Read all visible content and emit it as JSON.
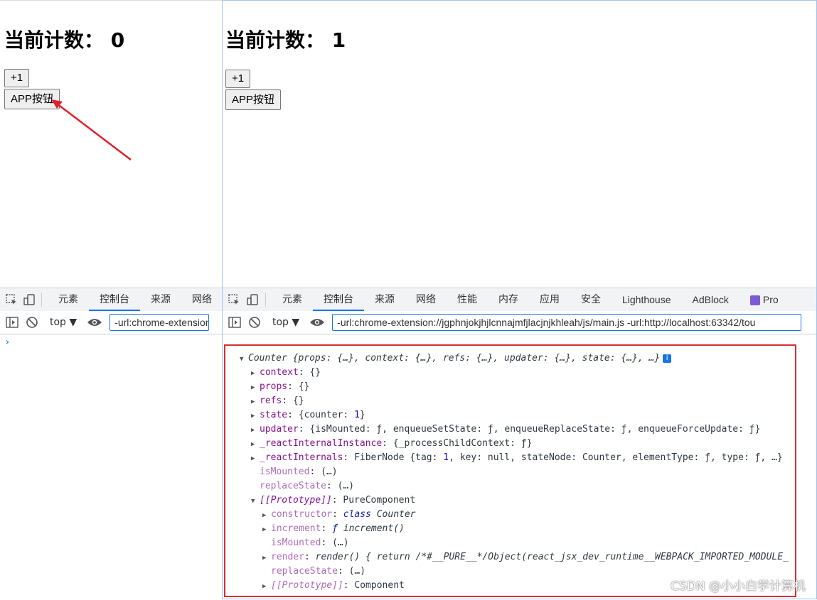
{
  "left": {
    "counter_text": "当前计数：  0",
    "plus_button": "+1",
    "app_button": "APP按钮",
    "tabs": [
      "元素",
      "控制台",
      "来源",
      "网络"
    ],
    "context": "top ▼",
    "filter": "-url:chrome-extension://jgphnjokjhjlcnnajmfjlacjnjkhleah/js/main.js",
    "prompt": "›"
  },
  "right": {
    "counter_text": "当前计数：  1",
    "plus_button": "+1",
    "app_button": "APP按钮",
    "tabs": [
      "元素",
      "控制台",
      "来源",
      "网络",
      "性能",
      "内存",
      "应用",
      "安全",
      "Lighthouse",
      "AdBlock",
      "Pro"
    ],
    "context": "top ▼",
    "filter": "-url:chrome-extension://jgphnjokjhjlcnnajmfjlacjnjkhleah/js/main.js -url:http://localhost:63342/tou"
  },
  "console": {
    "header_name": "Counter",
    "header_summary": "{props: {…}, context: {…}, refs: {…}, updater: {…}, state: {…}, …}",
    "info_badge": "i",
    "context": {
      "key": "context",
      "value": "{}"
    },
    "props": {
      "key": "props",
      "value": "{}"
    },
    "refs": {
      "key": "refs",
      "value": "{}"
    },
    "state": {
      "key": "state",
      "pre": "{counter: ",
      "num": "1",
      "post": "}"
    },
    "updater": {
      "key": "updater",
      "value": "{isMounted: ƒ, enqueueSetState: ƒ, enqueueReplaceState: ƒ, enqueueForceUpdate: ƒ}"
    },
    "internal_instance": {
      "key": "_reactInternalInstance",
      "value": "{_processChildContext: ƒ}"
    },
    "internals": {
      "key": "_reactInternals",
      "pre": "FiberNode {tag: ",
      "num": "1",
      "post": ", key: null, stateNode: Counter, elementType: ƒ, type: ƒ, …}"
    },
    "is_mounted": {
      "key": "isMounted",
      "value": "(…)"
    },
    "replace_state": {
      "key": "replaceState",
      "value": "(…)"
    },
    "prototype": {
      "key": "[[Prototype]]",
      "value": "PureComponent"
    },
    "constructor": {
      "key": "constructor",
      "kw": "class",
      "value": "Counter"
    },
    "increment": {
      "key": "increment",
      "kw": "ƒ",
      "value": "increment()"
    },
    "proto_is_mounted": {
      "key": "isMounted",
      "value": "(…)"
    },
    "render": {
      "key": "render",
      "value": "render() { return /*#__PURE__*/Object(react_jsx_dev_runtime__WEBPACK_IMPORTED_MODULE_"
    },
    "proto_replace_state": {
      "key": "replaceState",
      "value": "(…)"
    },
    "proto_proto": {
      "key": "[[Prototype]]",
      "value": "Component"
    }
  },
  "watermark": "CSDN @小小白学计算机",
  "colors": {
    "annotation_arrow": "#e0202a",
    "console_frame": "#d32f2f",
    "active_tab": "#1a73e8"
  }
}
